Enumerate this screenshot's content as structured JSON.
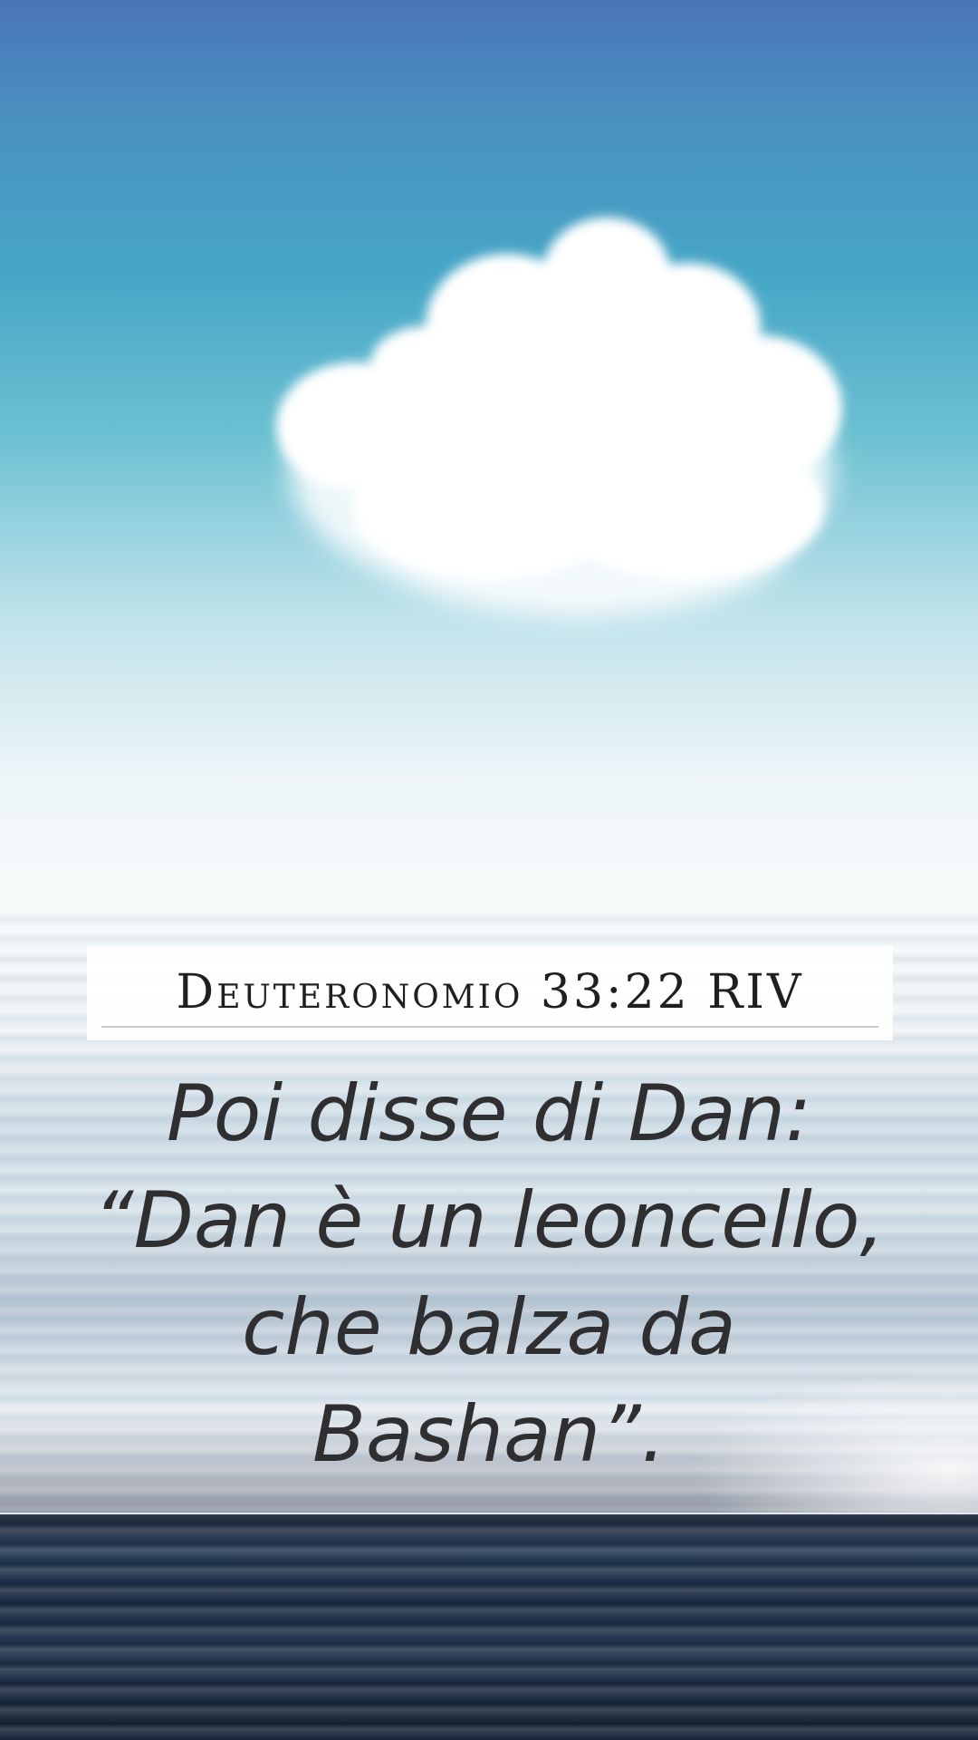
{
  "reference": "Deuteronomio 33:22 RIV",
  "verse": "Poi disse di Dan: “Dan è un leoncello, che balza da Bashan”."
}
